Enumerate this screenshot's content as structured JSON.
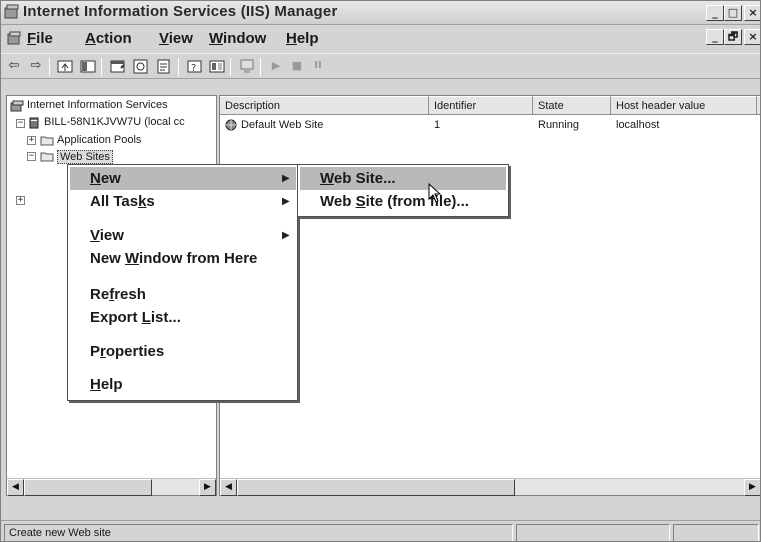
{
  "window": {
    "title": "Internet Information Services (IIS) Manager",
    "controls": {
      "minimize": "_",
      "maximize": "□",
      "close": "×"
    },
    "doc_controls": {
      "minimize": "_",
      "restore": "🗗",
      "close": "×"
    }
  },
  "menubar": [
    {
      "pre": "",
      "u": "F",
      "post": "ile"
    },
    {
      "pre": "",
      "u": "A",
      "post": "ction"
    },
    {
      "pre": "",
      "u": "V",
      "post": "iew"
    },
    {
      "pre": "",
      "u": "W",
      "post": "indow"
    },
    {
      "pre": "",
      "u": "H",
      "post": "elp"
    }
  ],
  "toolbar": {
    "icons": [
      "back-arrow-icon",
      "forward-arrow-icon",
      "up-folder-icon",
      "show-hide-tree-icon",
      "properties-icon",
      "refresh-icon",
      "export-list-icon",
      "help-icon",
      "show-console-tree-icon",
      "computer-icon",
      "play-icon",
      "stop-icon",
      "pause-icon"
    ],
    "glyphs": {
      "back": "⇦",
      "forward": "⇨",
      "play": "▶",
      "stop": "■",
      "pause": "II"
    }
  },
  "tree": {
    "root": "Internet Information Services",
    "server": "BILL-58N1KJVW7U (local cc",
    "app_pools": "Application Pools",
    "web_sites": "Web Sites",
    "expander_plus": "+",
    "expander_minus": "−"
  },
  "list": {
    "columns": [
      "Description",
      "Identifier",
      "State",
      "Host header value"
    ],
    "rows": [
      {
        "description": "Default Web Site",
        "identifier": "1",
        "state": "Running",
        "host_header": "localhost"
      }
    ]
  },
  "context_menu": {
    "new": {
      "pre": "",
      "u": "N",
      "post": "ew"
    },
    "all_tasks": {
      "pre": "All Tas",
      "u": "k",
      "post": "s"
    },
    "view": {
      "pre": "",
      "u": "V",
      "post": "iew"
    },
    "new_window": {
      "pre": "New ",
      "u": "W",
      "post": "indow from Here"
    },
    "refresh": {
      "pre": "Re",
      "u": "f",
      "post": "resh"
    },
    "export_list": {
      "pre": "Export ",
      "u": "L",
      "post": "ist..."
    },
    "properties": {
      "pre": "P",
      "u": "r",
      "post": "operties"
    },
    "help": {
      "pre": "",
      "u": "H",
      "post": "elp"
    },
    "submenu_arrow": "▶"
  },
  "submenu": {
    "web_site": {
      "pre": "",
      "u": "W",
      "post": "eb Site..."
    },
    "web_site_from_file": {
      "pre": "Web ",
      "u": "S",
      "post": "ite (from file)..."
    }
  },
  "statusbar": {
    "text": "Create new Web site"
  },
  "scroll": {
    "left": "◀",
    "right": "▶"
  },
  "colors": {
    "menu_highlight": "#b9b9b9",
    "chrome": "#d4d4d4"
  }
}
